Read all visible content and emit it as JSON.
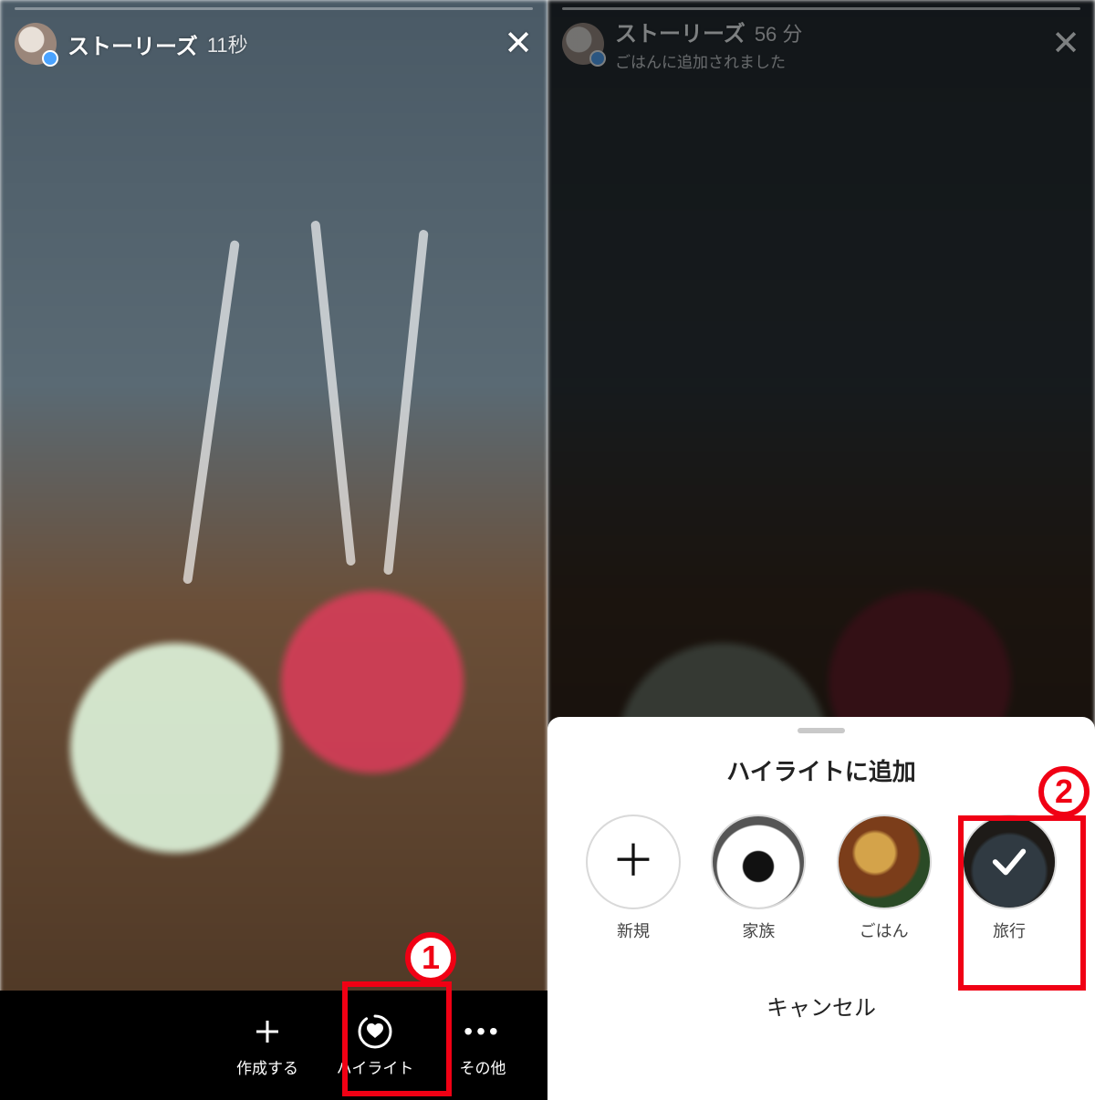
{
  "left": {
    "header": {
      "title": "ストーリーズ",
      "time": "11秒"
    },
    "bottom": {
      "create": "作成する",
      "highlight": "ハイライト",
      "more": "その他"
    }
  },
  "right": {
    "header": {
      "title": "ストーリーズ",
      "time": "56 分",
      "subtitle": "ごはんに追加されました"
    },
    "sheet": {
      "title": "ハイライトに追加",
      "new": "新規",
      "items": [
        {
          "label": "家族"
        },
        {
          "label": "ごはん"
        },
        {
          "label": "旅行"
        }
      ],
      "cancel": "キャンセル"
    }
  },
  "annotations": {
    "step1": "1",
    "step2": "2"
  }
}
